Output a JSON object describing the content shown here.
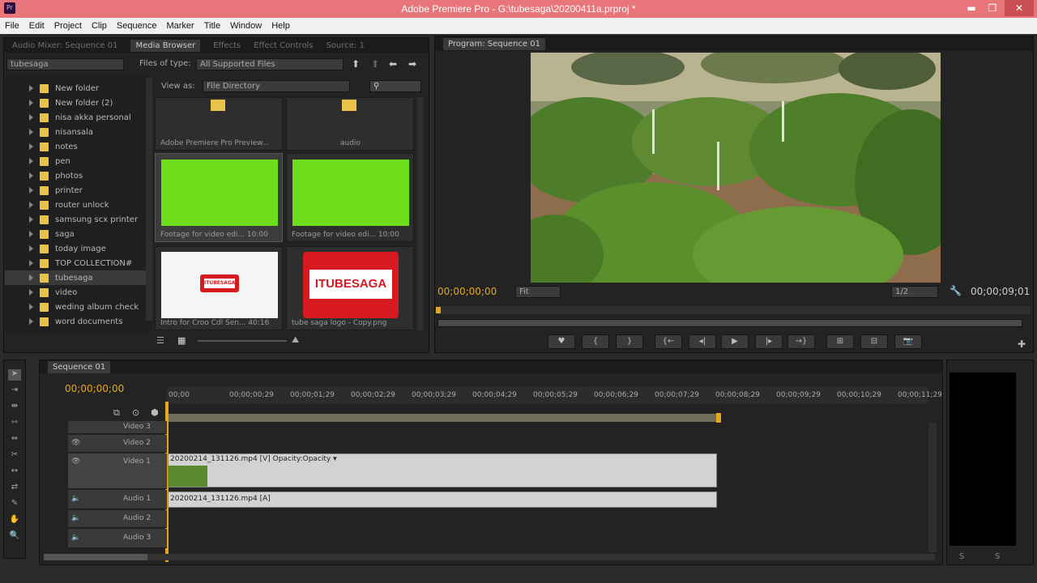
{
  "window": {
    "title": "Adobe Premiere Pro - G:\\tubesaga\\20200411a.prproj *",
    "app_icon": "Pr",
    "btn_min": "▬",
    "btn_max": "❐",
    "btn_close": "✕"
  },
  "menu": [
    "File",
    "Edit",
    "Project",
    "Clip",
    "Sequence",
    "Marker",
    "Title",
    "Window",
    "Help"
  ],
  "left_tabs": [
    "Audio Mixer: Sequence 01",
    "Media Browser",
    "Effects",
    "Effect Controls",
    "Source: 1"
  ],
  "media_browser": {
    "location": "tubesaga",
    "files_of_type_label": "Files of type:",
    "files_of_type_value": "All Supported Files",
    "view_as_label": "View as:",
    "view_as_value": "File Directory",
    "search_placeholder": "",
    "folders": [
      "New folder",
      "New folder (2)",
      "nisa akka personal",
      "nisansala",
      "notes",
      "pen",
      "photos",
      "printer",
      "router unlock",
      "samsung scx printer",
      "saga",
      "today image",
      "TOP COLLECTION#",
      "tubesaga",
      "video",
      "weding album check",
      "word documents"
    ],
    "thumbs": [
      {
        "caption": "Adobe Premiere Pro Preview..."
      },
      {
        "caption": "audio"
      },
      {
        "caption": "Footage for video edi... 10:00"
      },
      {
        "caption": "Footage for video edi... 10:00"
      },
      {
        "caption": "Intro for Croo  Cdl  Sen...  40:16"
      },
      {
        "caption": "tube saga logo - Copy.png"
      }
    ],
    "logo_text": "ITUBESAGA",
    "logo_small_text": "ITUBESAGA"
  },
  "program": {
    "tab": "Program: Sequence 01",
    "timecode_left": "00;00;00;00",
    "fit": "Fit",
    "resolution": "1/2",
    "timecode_right": "00;00;09;01"
  },
  "transport": [
    "♥",
    "{",
    "}",
    "{←",
    "◂|",
    "▶",
    "|▸",
    "→}",
    "⊞",
    "⊟",
    "📷"
  ],
  "timeline": {
    "tab": "Sequence 01",
    "timecode": "00;00;00;00",
    "ruler": [
      "00;00",
      "00;00;00;29",
      "00;00;01;29",
      "00;00;02;29",
      "00;00;03;29",
      "00;00;04;29",
      "00;00;05;29",
      "00;00;06;29",
      "00;00;07;29",
      "00;00;08;29",
      "00;00;09;29",
      "00;00;10;29",
      "00;00;11;29"
    ],
    "tracks": {
      "video3": "Video 3",
      "video2": "Video 2",
      "video1": "Video 1",
      "audio1": "Audio 1",
      "audio2": "Audio 2",
      "audio3": "Audio 3"
    },
    "video_clip": "20200214_131126.mp4 [V]  Opacity:Opacity ▾",
    "audio_clip": "20200214_131126.mp4 [A]",
    "clip_end_fraction": 0.9
  },
  "colors": {
    "green": "#6ddc1b",
    "accent": "#e6a61c",
    "logo_red": "#d71920"
  }
}
